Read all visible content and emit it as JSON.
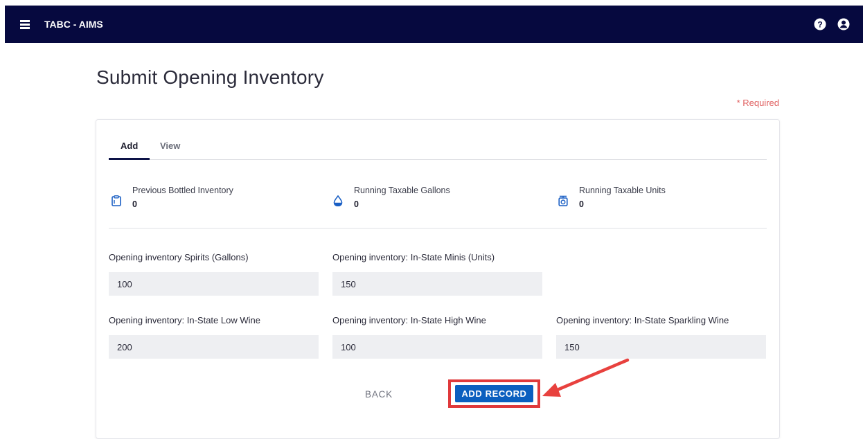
{
  "header": {
    "app_title": "TABC - AIMS",
    "menu_icon": "hamburger-menu-icon",
    "help_icon": "help-circle-icon",
    "user_icon": "user-account-icon",
    "bg_color": "#06093f"
  },
  "page": {
    "title": "Submit Opening Inventory",
    "required_note": "* Required"
  },
  "tabs": [
    {
      "label": "Add",
      "active": true
    },
    {
      "label": "View",
      "active": false
    }
  ],
  "stats": [
    {
      "label": "Previous Bottled Inventory",
      "value": "0",
      "icon": "clipboard-icon"
    },
    {
      "label": "Running Taxable Gallons",
      "value": "0",
      "icon": "water-drop-icon"
    },
    {
      "label": "Running Taxable Units",
      "value": "0",
      "icon": "scale-weight-icon"
    }
  ],
  "fields": [
    {
      "label": "Opening inventory Spirits (Gallons)",
      "value": "100"
    },
    {
      "label": "Opening inventory: In-State Minis (Units)",
      "value": "150"
    },
    {
      "label": "Opening inventory: In-State Low Wine",
      "value": "200"
    },
    {
      "label": "Opening inventory: In-State High Wine",
      "value": "100"
    },
    {
      "label": "Opening inventory: In-State Sparkling Wine",
      "value": "150"
    }
  ],
  "actions": {
    "back_label": "BACK",
    "add_label": "ADD RECORD"
  },
  "colors": {
    "primary_button": "#0b5fbf",
    "highlight_annotation": "#e0393b",
    "required_text": "#e06060"
  }
}
